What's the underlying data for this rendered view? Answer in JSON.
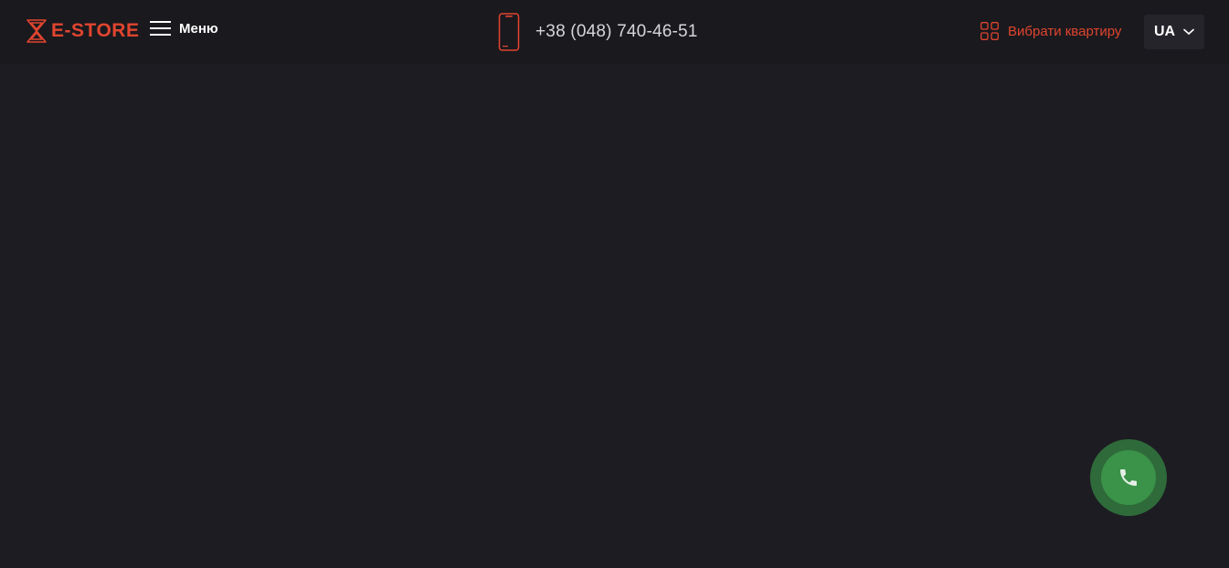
{
  "header": {
    "logo_text": "E-STORE",
    "menu_label": "Меню",
    "phone": "+38 (048) 740-46-51",
    "choose_apartment_label": "Вибрати квартиру",
    "language": "UA"
  },
  "icons": {
    "logo": "hourglass-logo-icon",
    "menu": "burger-menu-icon",
    "phone": "smartphone-icon",
    "choose_apartment": "grid-icon",
    "language": "chevron-down-icon",
    "call_button": "phone-handset-icon"
  },
  "colors": {
    "accent": "#e0452f",
    "background": "#1d1c22",
    "header": "#1a191e",
    "call_button": "#3a9348",
    "call_button_ring": "#2f6a3a"
  }
}
